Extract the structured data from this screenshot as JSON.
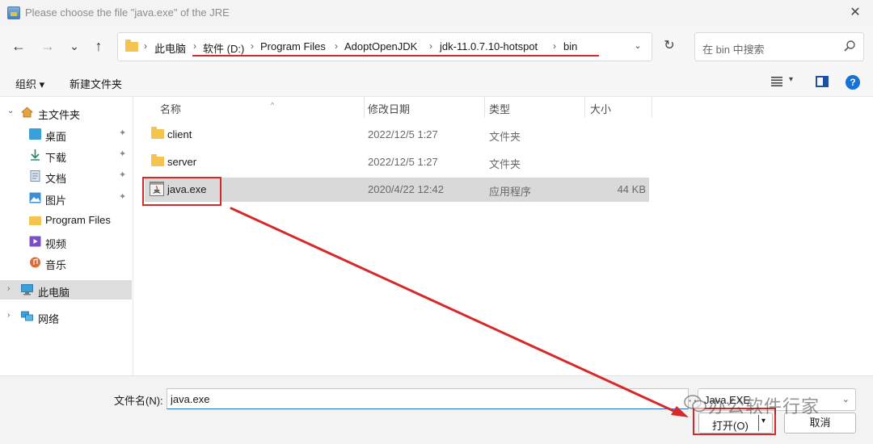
{
  "window": {
    "title": "Please choose the file \"java.exe\" of the JRE",
    "close_glyph": "✕"
  },
  "nav": {
    "back_glyph": "←",
    "forward_glyph": "→",
    "recent_glyph": "⌄",
    "up_glyph": "↑",
    "breadcrumbs": [
      "此电脑",
      "软件 (D:)",
      "Program Files",
      "AdoptOpenJDK",
      "jdk-11.0.7.10-hotspot",
      "bin"
    ],
    "separator": "›",
    "dropdown_glyph": "⌄",
    "refresh_glyph": "↻",
    "search_placeholder": "在 bin 中搜索"
  },
  "toolbar": {
    "organize_label": "组织 ▾",
    "new_folder_label": "新建文件夹",
    "view_dropdown_glyph": "▾",
    "help_glyph": "?"
  },
  "sidebar": {
    "quick_access": "主文件夹",
    "items": [
      {
        "label": "桌面",
        "icon": "desktop-icon",
        "pinned": true
      },
      {
        "label": "下载",
        "icon": "download-icon",
        "pinned": true
      },
      {
        "label": "文档",
        "icon": "document-icon",
        "pinned": true
      },
      {
        "label": "图片",
        "icon": "picture-icon",
        "pinned": true
      },
      {
        "label": "Program Files",
        "icon": "folder-icon",
        "pinned": false
      },
      {
        "label": "视频",
        "icon": "video-icon",
        "pinned": false
      },
      {
        "label": "音乐",
        "icon": "music-icon",
        "pinned": false
      }
    ],
    "this_pc": "此电脑",
    "network": "网络",
    "expand_glyph": "›",
    "expanded_glyph": "⌄",
    "pin_glyph": "📌"
  },
  "columns": {
    "name": "名称",
    "date": "修改日期",
    "type": "类型",
    "size": "大小",
    "sort_glyph": "^"
  },
  "files": [
    {
      "name": "client",
      "date": "2022/12/5 1:27",
      "type": "文件夹",
      "size": "",
      "icon": "folder-icon"
    },
    {
      "name": "server",
      "date": "2022/12/5 1:27",
      "type": "文件夹",
      "size": "",
      "icon": "folder-icon"
    },
    {
      "name": "java.exe",
      "date": "2020/4/22 12:42",
      "type": "应用程序",
      "size": "44 KB",
      "icon": "java-exe-icon",
      "selected": true
    }
  ],
  "footer": {
    "filename_label": "文件名(N):",
    "filename_value": "java.exe",
    "filetype_value": "Java.EXE",
    "filetype_arrow": "⌄",
    "open_label": "打开(O)",
    "open_dropdown_glyph": "▾",
    "cancel_label": "取消"
  },
  "watermark": {
    "text": "办公软件行家"
  },
  "colors": {
    "annotation_red": "#d62a2a",
    "folder_yellow": "#f3c44f",
    "selection_gray": "#d9d9d9",
    "help_blue": "#1672d6"
  }
}
